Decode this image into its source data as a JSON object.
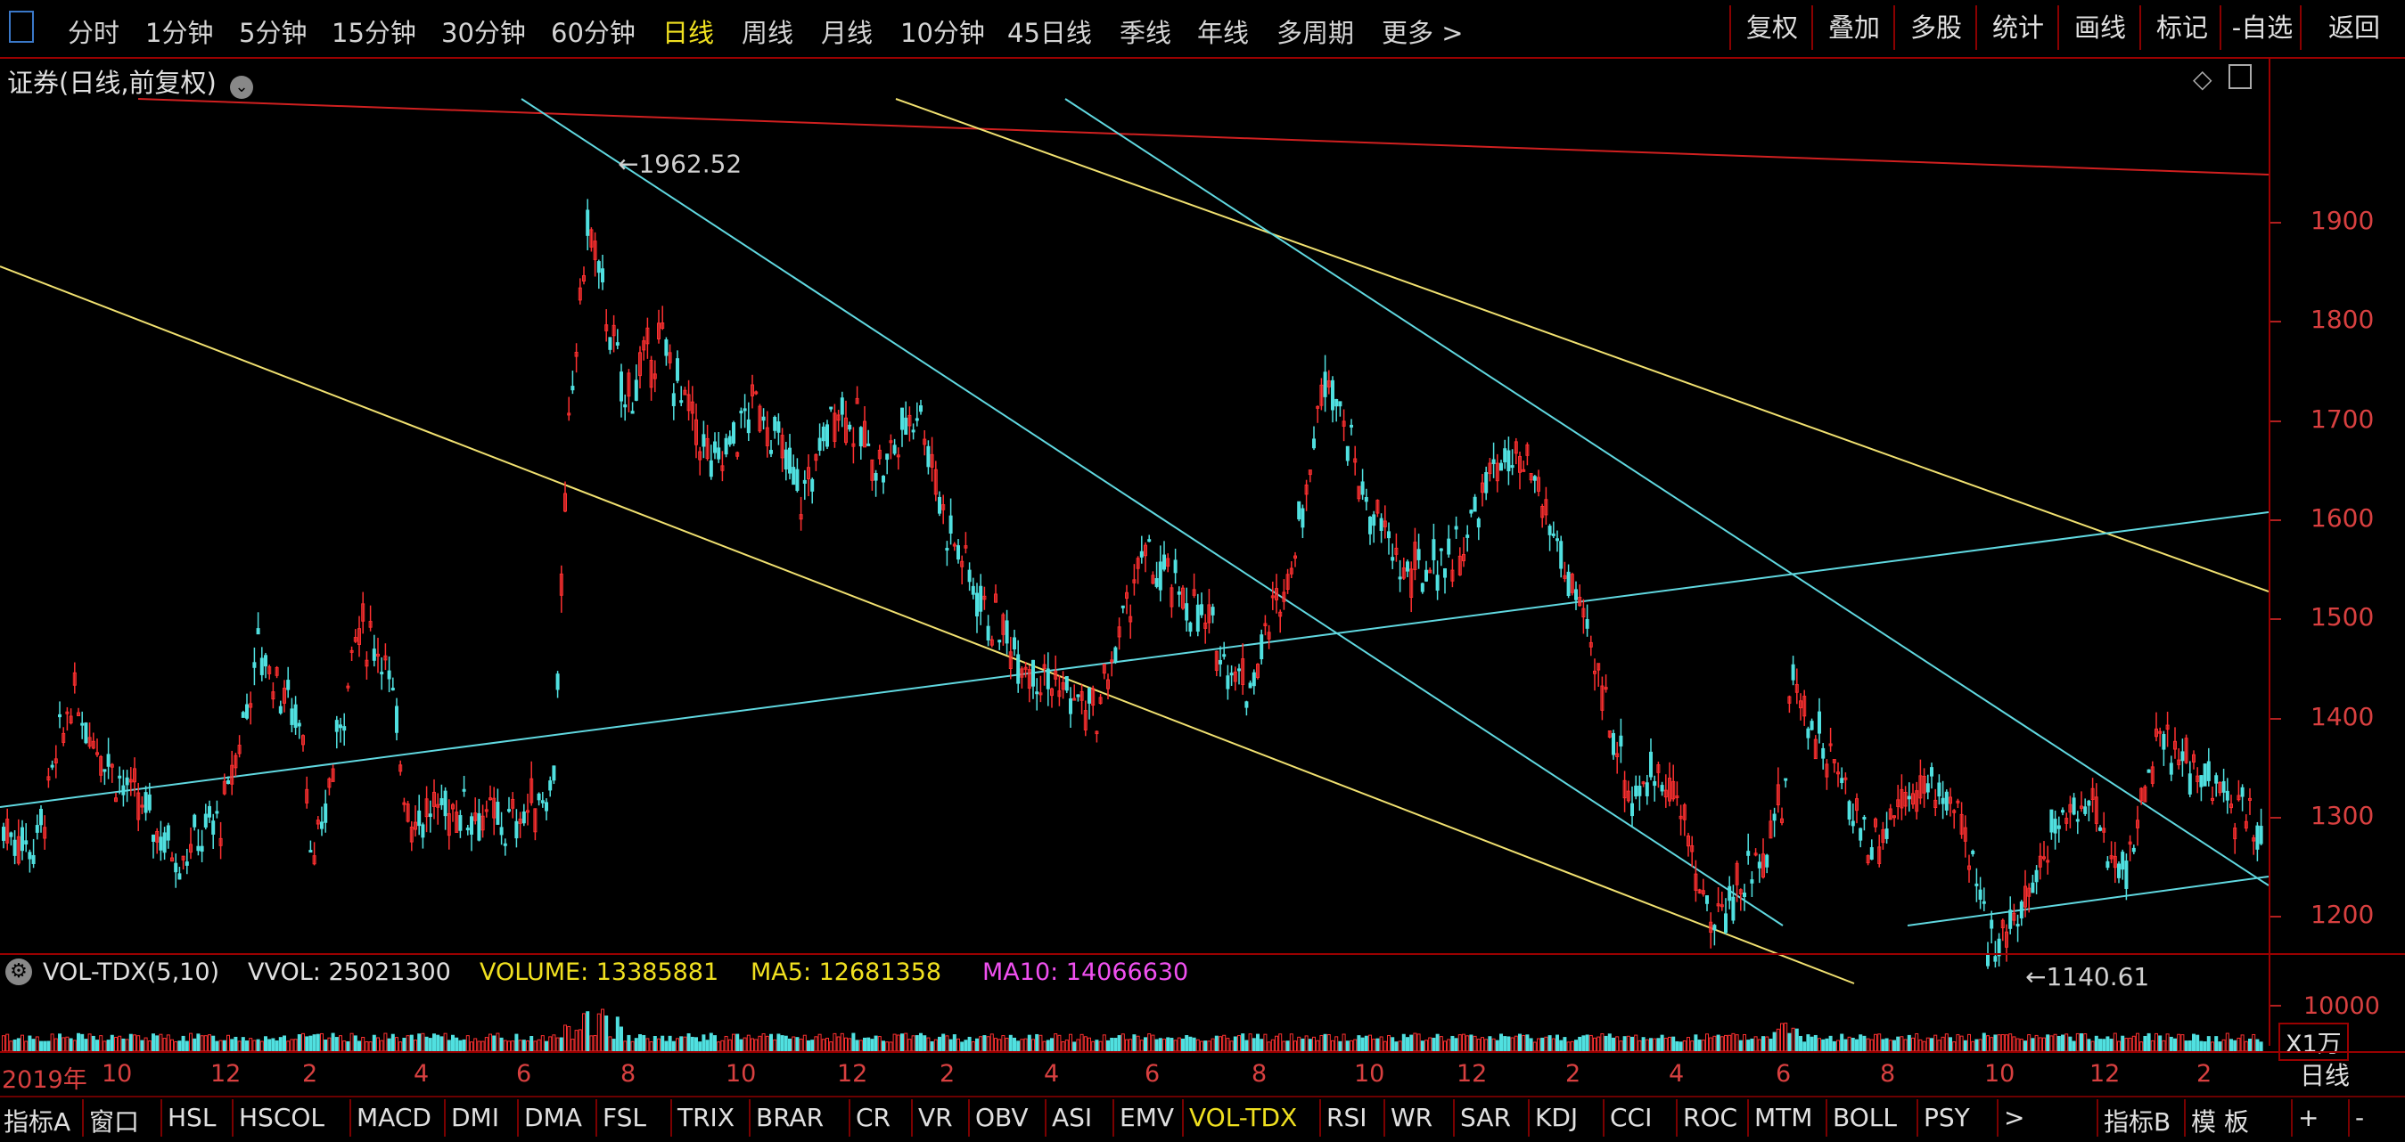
{
  "toolbar": {
    "periods": [
      "分时",
      "1分钟",
      "5分钟",
      "15分钟",
      "30分钟",
      "60分钟",
      "日线",
      "周线",
      "月线",
      "10分钟",
      "45日线",
      "季线",
      "年线",
      "多周期",
      "更多 >"
    ],
    "active_period": "日线",
    "actions": [
      "复权",
      "叠加",
      "多股",
      "统计",
      "画线",
      "标记",
      "-自选",
      "返回"
    ]
  },
  "chart": {
    "title": "证券(日线,前复权)",
    "high_label": "1962.52",
    "low_label": "1140.61",
    "y_ticks": [
      "1900",
      "1800",
      "1700",
      "1600",
      "1500",
      "1400",
      "1300",
      "1200"
    ]
  },
  "volume": {
    "indicator": "VOL-TDX(5,10)",
    "vvol": "VVOL: 25021300",
    "volume": "VOLUME: 13385881",
    "ma5": "MA5: 12681358",
    "ma10": "MA10: 14066630",
    "y_tick": "10000",
    "unit": "X1万"
  },
  "x_axis": {
    "labels": [
      "2019年",
      "10",
      "12",
      "2",
      "4",
      "6",
      "8",
      "10",
      "12",
      "2",
      "4",
      "6",
      "8",
      "10",
      "12",
      "2",
      "4",
      "6",
      "8",
      "10",
      "12",
      "2"
    ]
  },
  "bottom": {
    "left_tabs": [
      "指标A",
      "窗口",
      "HSL",
      "HSCOL",
      "MACD",
      "DMI",
      "DMA",
      "FSL",
      "TRIX",
      "BRAR",
      "CR",
      "VR",
      "OBV",
      "ASI",
      "EMV",
      "VOL-TDX",
      "RSI",
      "WR",
      "SAR",
      "KDJ",
      "CCI",
      "ROC",
      "MTM",
      "BOLL",
      "PSY",
      ">"
    ],
    "active_tab": "VOL-TDX",
    "right_tabs": [
      "指标B",
      "模 板",
      "+",
      "-"
    ],
    "period_label": "日线"
  },
  "colors": {
    "up": "#ff3030",
    "down": "#50e0e0",
    "axis": "#9a0000",
    "trend_red": "#d02020",
    "trend_yellow": "#f0e070",
    "trend_cyan": "#60d8e0"
  }
}
